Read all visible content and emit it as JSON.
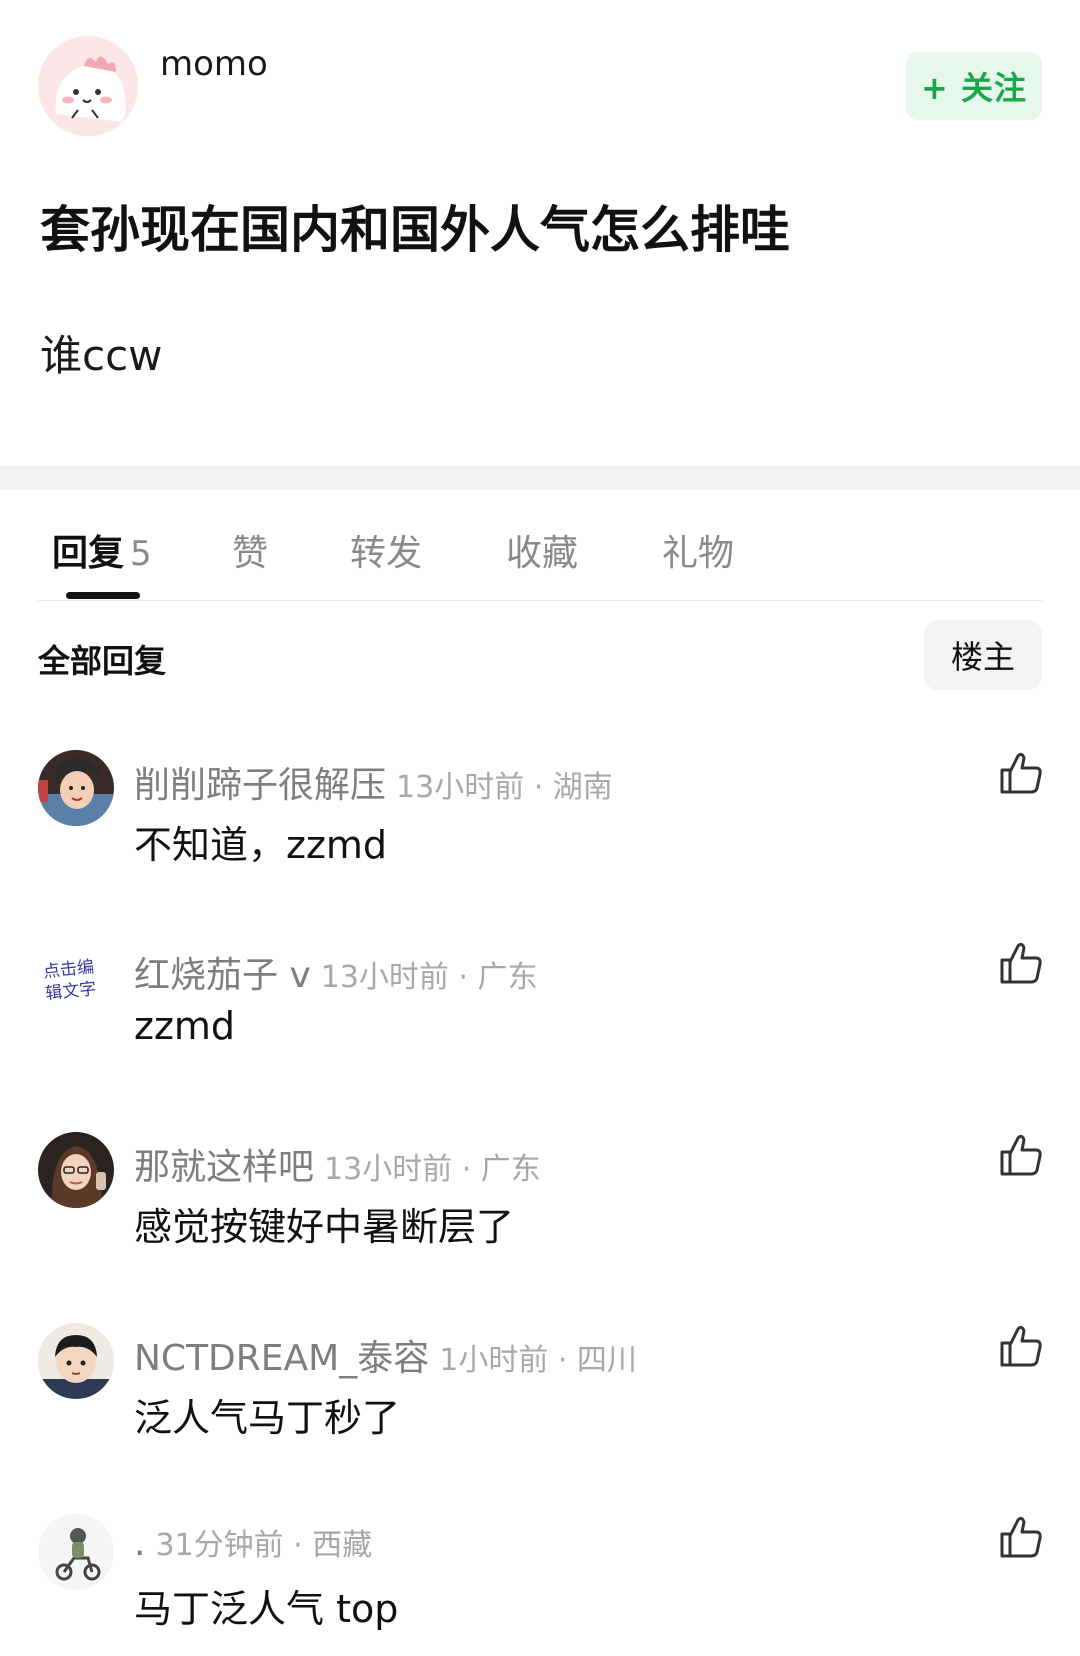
{
  "post": {
    "author_name": "momo",
    "follow_label": "+ 关注",
    "title": "套孙现在国内和国外人气怎么排哇",
    "body": "谁ccw"
  },
  "tabs": [
    {
      "label": "回复",
      "count": "5"
    },
    {
      "label": "赞"
    },
    {
      "label": "转发"
    },
    {
      "label": "收藏"
    },
    {
      "label": "礼物"
    }
  ],
  "section": {
    "title": "全部回复",
    "op_filter": "楼主"
  },
  "comments": [
    {
      "name": "削削蹄子很解压",
      "time": "13小时前 · 湖南",
      "text": "不知道，zzmd"
    },
    {
      "name": "红烧茄子 v",
      "time": "13小时前 · 广东",
      "text": "zzmd"
    },
    {
      "name": "那就这样吧",
      "time": "13小时前 · 广东",
      "text": "感觉按键好中暑断层了"
    },
    {
      "name": "NCTDREAM_泰容",
      "time": "1小时前 · 四川",
      "text": "泛人气马丁秒了"
    },
    {
      "name": ".",
      "time": "31分钟前 · 西藏",
      "text": "马丁泛人气 top"
    }
  ],
  "avatar_text": "点击编辑文字",
  "colors": {
    "follow_bg": "#e8f7ec",
    "follow_text": "#1aa64a",
    "muted": "#7e7e7e",
    "divider": "#f1f1f3"
  },
  "icons": [
    "thumbs-up-icon"
  ]
}
